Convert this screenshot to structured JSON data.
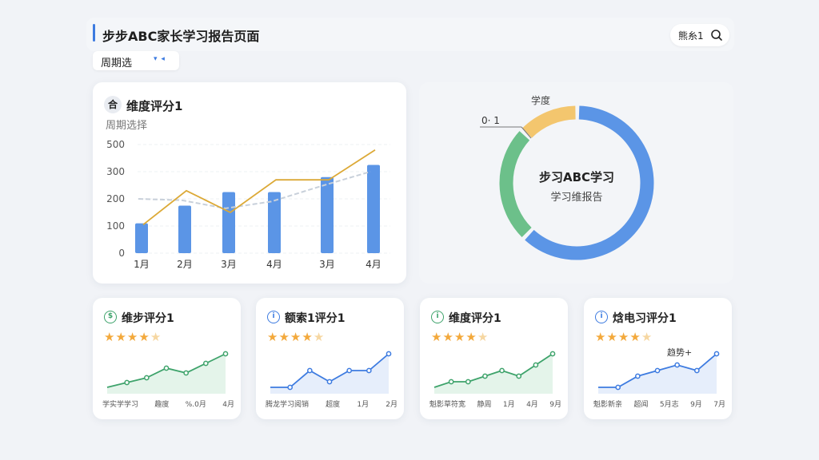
{
  "header": {
    "title": "步步ABC家长学习报告页面",
    "right_label": "熊糸1",
    "accent_color": "#3d7be0"
  },
  "period": {
    "label": "周期选",
    "dropdown_glyph": "▾ ◂"
  },
  "main_card": {
    "icon_text": "合",
    "title": "维度评分1",
    "subtitle": "周期选择",
    "chart_data": {
      "type": "bar",
      "categories": [
        "1月",
        "2月",
        "3月",
        "4月",
        "3月",
        "4月"
      ],
      "ylim": [
        0,
        500
      ],
      "yticks": [
        "500",
        "300",
        "200",
        "100",
        "0"
      ],
      "series": [
        {
          "values": [
            110,
            175,
            225,
            225,
            280,
            350
          ],
          "kind": "bar",
          "color": "#5b95e6"
        },
        {
          "values": [
            105,
            230,
            150,
            270,
            270,
            460
          ],
          "kind": "line",
          "color": "#dca936"
        },
        {
          "values": [
            200,
            195,
            165,
            190,
            250,
            300
          ],
          "kind": "line",
          "color": "#c8d0da"
        }
      ]
    }
  },
  "donut_card": {
    "center_title": "步习ABC学习",
    "center_sub": "学习维报告",
    "top_label": "学度",
    "left_label": "0· 1",
    "chart_data": {
      "type": "pie",
      "slices": [
        {
          "value": 62,
          "color": "#5b95e6"
        },
        {
          "value": 25,
          "color": "#6cc08a"
        },
        {
          "value": 13,
          "color": "#f3c66e"
        }
      ]
    }
  },
  "small_cards": [
    {
      "icon": "$",
      "icon_color": "#3ea36b",
      "title": "维步评分1",
      "rating": 4.5,
      "line_color": "#3ea36b",
      "fill_color": "#d9f0e1",
      "axis": [
        "学实学学习",
        "趣度",
        "%.0月",
        "4月"
      ],
      "note": "",
      "chart_data": {
        "type": "line",
        "values": [
          1,
          2,
          3,
          5,
          4,
          6,
          8
        ]
      }
    },
    {
      "icon": "i",
      "icon_color": "#3d7be0",
      "title": "额索1评分1",
      "rating": 4.5,
      "line_color": "#3d7be0",
      "fill_color": "#dbe7fa",
      "axis": [
        "腾龙学习阅销",
        "超度",
        "1月",
        "2月"
      ],
      "note": "",
      "chart_data": {
        "type": "line",
        "values": [
          1,
          1,
          4,
          2,
          4,
          4,
          7
        ]
      }
    },
    {
      "icon": "i",
      "icon_color": "#3ea36b",
      "title": "维度评分1",
      "rating": 4.5,
      "line_color": "#3ea36b",
      "fill_color": "#d9f0e1",
      "axis": [
        "魁影草符宽",
        "静周",
        "1月",
        "4月",
        "9月"
      ],
      "note": "",
      "chart_data": {
        "type": "line",
        "values": [
          1,
          2,
          2,
          3,
          4,
          3,
          5,
          7
        ]
      }
    },
    {
      "icon": "i",
      "icon_color": "#3d7be0",
      "title": "焓电习评分1",
      "rating": 4.5,
      "line_color": "#3d7be0",
      "fill_color": "#dbe7fa",
      "axis": [
        "魁影新亲",
        "超闻",
        "5月志",
        "9月",
        "7月"
      ],
      "note": "趋势+",
      "chart_data": {
        "type": "line",
        "values": [
          1,
          1,
          3,
          4,
          5,
          4,
          7
        ]
      }
    }
  ]
}
